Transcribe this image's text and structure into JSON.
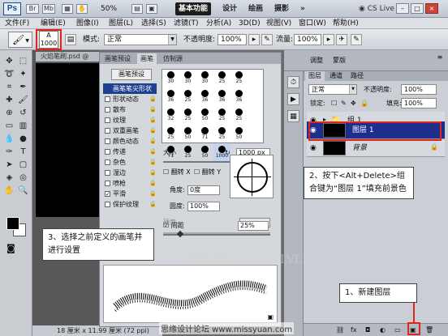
{
  "topbar": {
    "logo": "Ps",
    "zoom": "50%",
    "workspaces": [
      "基本功能",
      "设计",
      "绘画",
      "摄影"
    ],
    "cs_live": "CS Live",
    "window_buttons": [
      "–",
      "□",
      "×"
    ]
  },
  "menu": [
    "文件(F)",
    "编辑(E)",
    "图像(I)",
    "图层(L)",
    "选择(S)",
    "滤镜(T)",
    "分析(A)",
    "3D(D)",
    "视图(V)",
    "窗口(W)",
    "帮助(H)"
  ],
  "options": {
    "brush_size": "1000",
    "brush_size_top": "A",
    "mode_label": "模式:",
    "mode_value": "正常",
    "opacity_label": "不透明度:",
    "opacity_value": "100%",
    "flow_label": "流量:",
    "flow_value": "100%"
  },
  "document": {
    "tab_title": "火焰笔刷.psd @",
    "status": "18 厘米 x 11.99 厘米 (72 ppi)"
  },
  "brush_panel": {
    "tabs": [
      "画笔预设",
      "画笔",
      "仿制源"
    ],
    "preset_button": "画笔预设",
    "items": [
      {
        "label": "画笔笔尖形状",
        "checked": false,
        "selected": true
      },
      {
        "label": "形状动态",
        "checked": false,
        "selected": false
      },
      {
        "label": "散布",
        "checked": false,
        "selected": false
      },
      {
        "label": "纹理",
        "checked": false,
        "selected": false
      },
      {
        "label": "双重画笔",
        "checked": false,
        "selected": false
      },
      {
        "label": "颜色动态",
        "checked": false,
        "selected": false
      },
      {
        "label": "传递",
        "checked": false,
        "selected": false
      },
      {
        "label": "杂色",
        "checked": false,
        "selected": false
      },
      {
        "label": "湿边",
        "checked": false,
        "selected": false
      },
      {
        "label": "喷枪",
        "checked": false,
        "selected": false
      },
      {
        "label": "平滑",
        "checked": true,
        "selected": false
      },
      {
        "label": "保护纹理",
        "checked": false,
        "selected": false
      }
    ],
    "tip_sizes": [
      "30",
      "30",
      "30",
      "25",
      "25",
      "36",
      "25",
      "36",
      "36",
      "36",
      "32",
      "25",
      "50",
      "25",
      "25",
      "25",
      "50",
      "71",
      "25",
      "50",
      "71",
      "25",
      "50",
      "1000"
    ],
    "size_label": "大小",
    "size_value": "1000 px",
    "flip_x": "翻转 X",
    "flip_y": "翻转 Y",
    "angle_label": "角度:",
    "angle_value": "0度",
    "roundness_label": "圆度:",
    "roundness_value": "100%",
    "hardness_label": "硬度",
    "spacing_label": "间距",
    "spacing_checked": true,
    "spacing_value": "25%"
  },
  "callouts": {
    "step3": "3、选择之前定义的画笔并进行设置",
    "step2": "2、按下<Alt+Delete>组合键为“图层 1”填充前景色",
    "step1": "1、新建图层"
  },
  "adjust_panel": {
    "tabs": [
      "调整",
      "蒙版"
    ]
  },
  "layers_panel": {
    "tabs": [
      "图层",
      "通道",
      "路径"
    ],
    "blend_mode": "正常",
    "opacity_label": "不透明度:",
    "opacity_value": "100%",
    "lock_label": "锁定:",
    "fill_label": "填充:",
    "fill_value": "100%",
    "layers": [
      {
        "name": "组 1",
        "type": "group",
        "selected": false
      },
      {
        "name": "图层 1",
        "type": "layer",
        "selected": true
      },
      {
        "name": "背景",
        "type": "background",
        "selected": false
      }
    ],
    "bottom_icons": [
      "链接",
      "fx",
      "蒙版",
      "调整",
      "组",
      "新建",
      "删除"
    ]
  },
  "watermarks": {
    "main": "腾龍視覺 WWW.TLVI.NET",
    "footer": "思缘设计论坛 www.missyuan.com"
  }
}
